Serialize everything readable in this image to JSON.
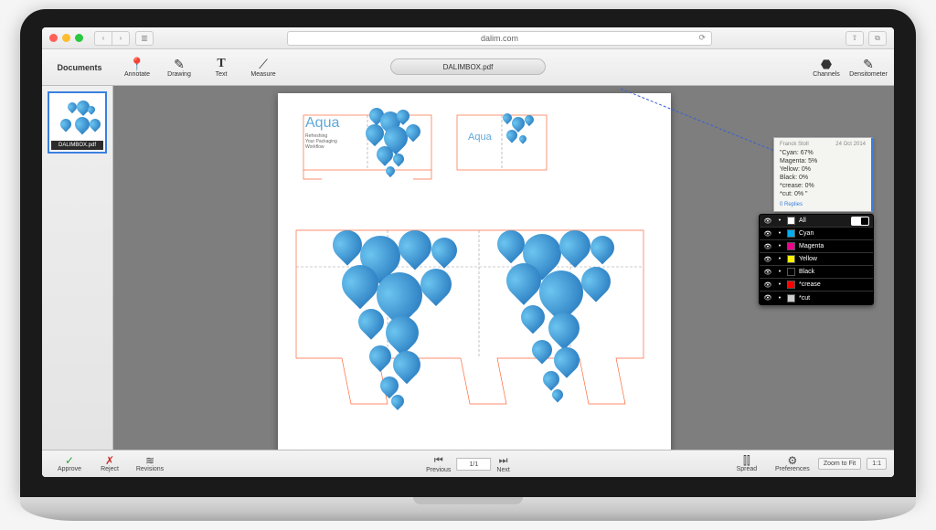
{
  "browser": {
    "url": "dalim.com"
  },
  "sidebar": {
    "header": "Documents",
    "thumb_label": "DALIMBOX.pdf"
  },
  "toolbar": {
    "annotate": "Annotate",
    "drawing": "Drawing",
    "text": "Text",
    "measure": "Measure",
    "channels": "Channels",
    "densitometer": "Densitometer",
    "doc_title": "DALIMBOX.pdf"
  },
  "artwork": {
    "brand": "Aqua",
    "tagline_l1": "Refreshing",
    "tagline_l2": "Your Packaging",
    "tagline_l3": "Workflow",
    "brand_small": "Aqua"
  },
  "annotation": {
    "author": "Franck Stoll",
    "date": "24 Oct 2014",
    "lines": {
      "l1": "\"Cyan: 67%",
      "l2": "Magenta: 5%",
      "l3": "Yellow: 0%",
      "l4": "Black: 0%",
      "l5": "*crease: 0%",
      "l6": "*cut: 0% \""
    },
    "replies": "0 Replies"
  },
  "channels_panel": {
    "all": "All",
    "rows": [
      {
        "label": "Cyan",
        "swatch": "#00aeef"
      },
      {
        "label": "Magenta",
        "swatch": "#ec008c"
      },
      {
        "label": "Yellow",
        "swatch": "#fff200"
      },
      {
        "label": "Black",
        "swatch": "#000000"
      },
      {
        "label": "*crease",
        "swatch": "#ff0000"
      },
      {
        "label": "*cut",
        "swatch": "#cccccc"
      }
    ]
  },
  "footer": {
    "approve": "Approve",
    "reject": "Reject",
    "revisions": "Revisions",
    "previous": "Previous",
    "next": "Next",
    "page": "1/1",
    "spread": "Spread",
    "preferences": "Preferences",
    "zoom_fit": "Zoom to Fit",
    "zoom_11": "1:1"
  }
}
